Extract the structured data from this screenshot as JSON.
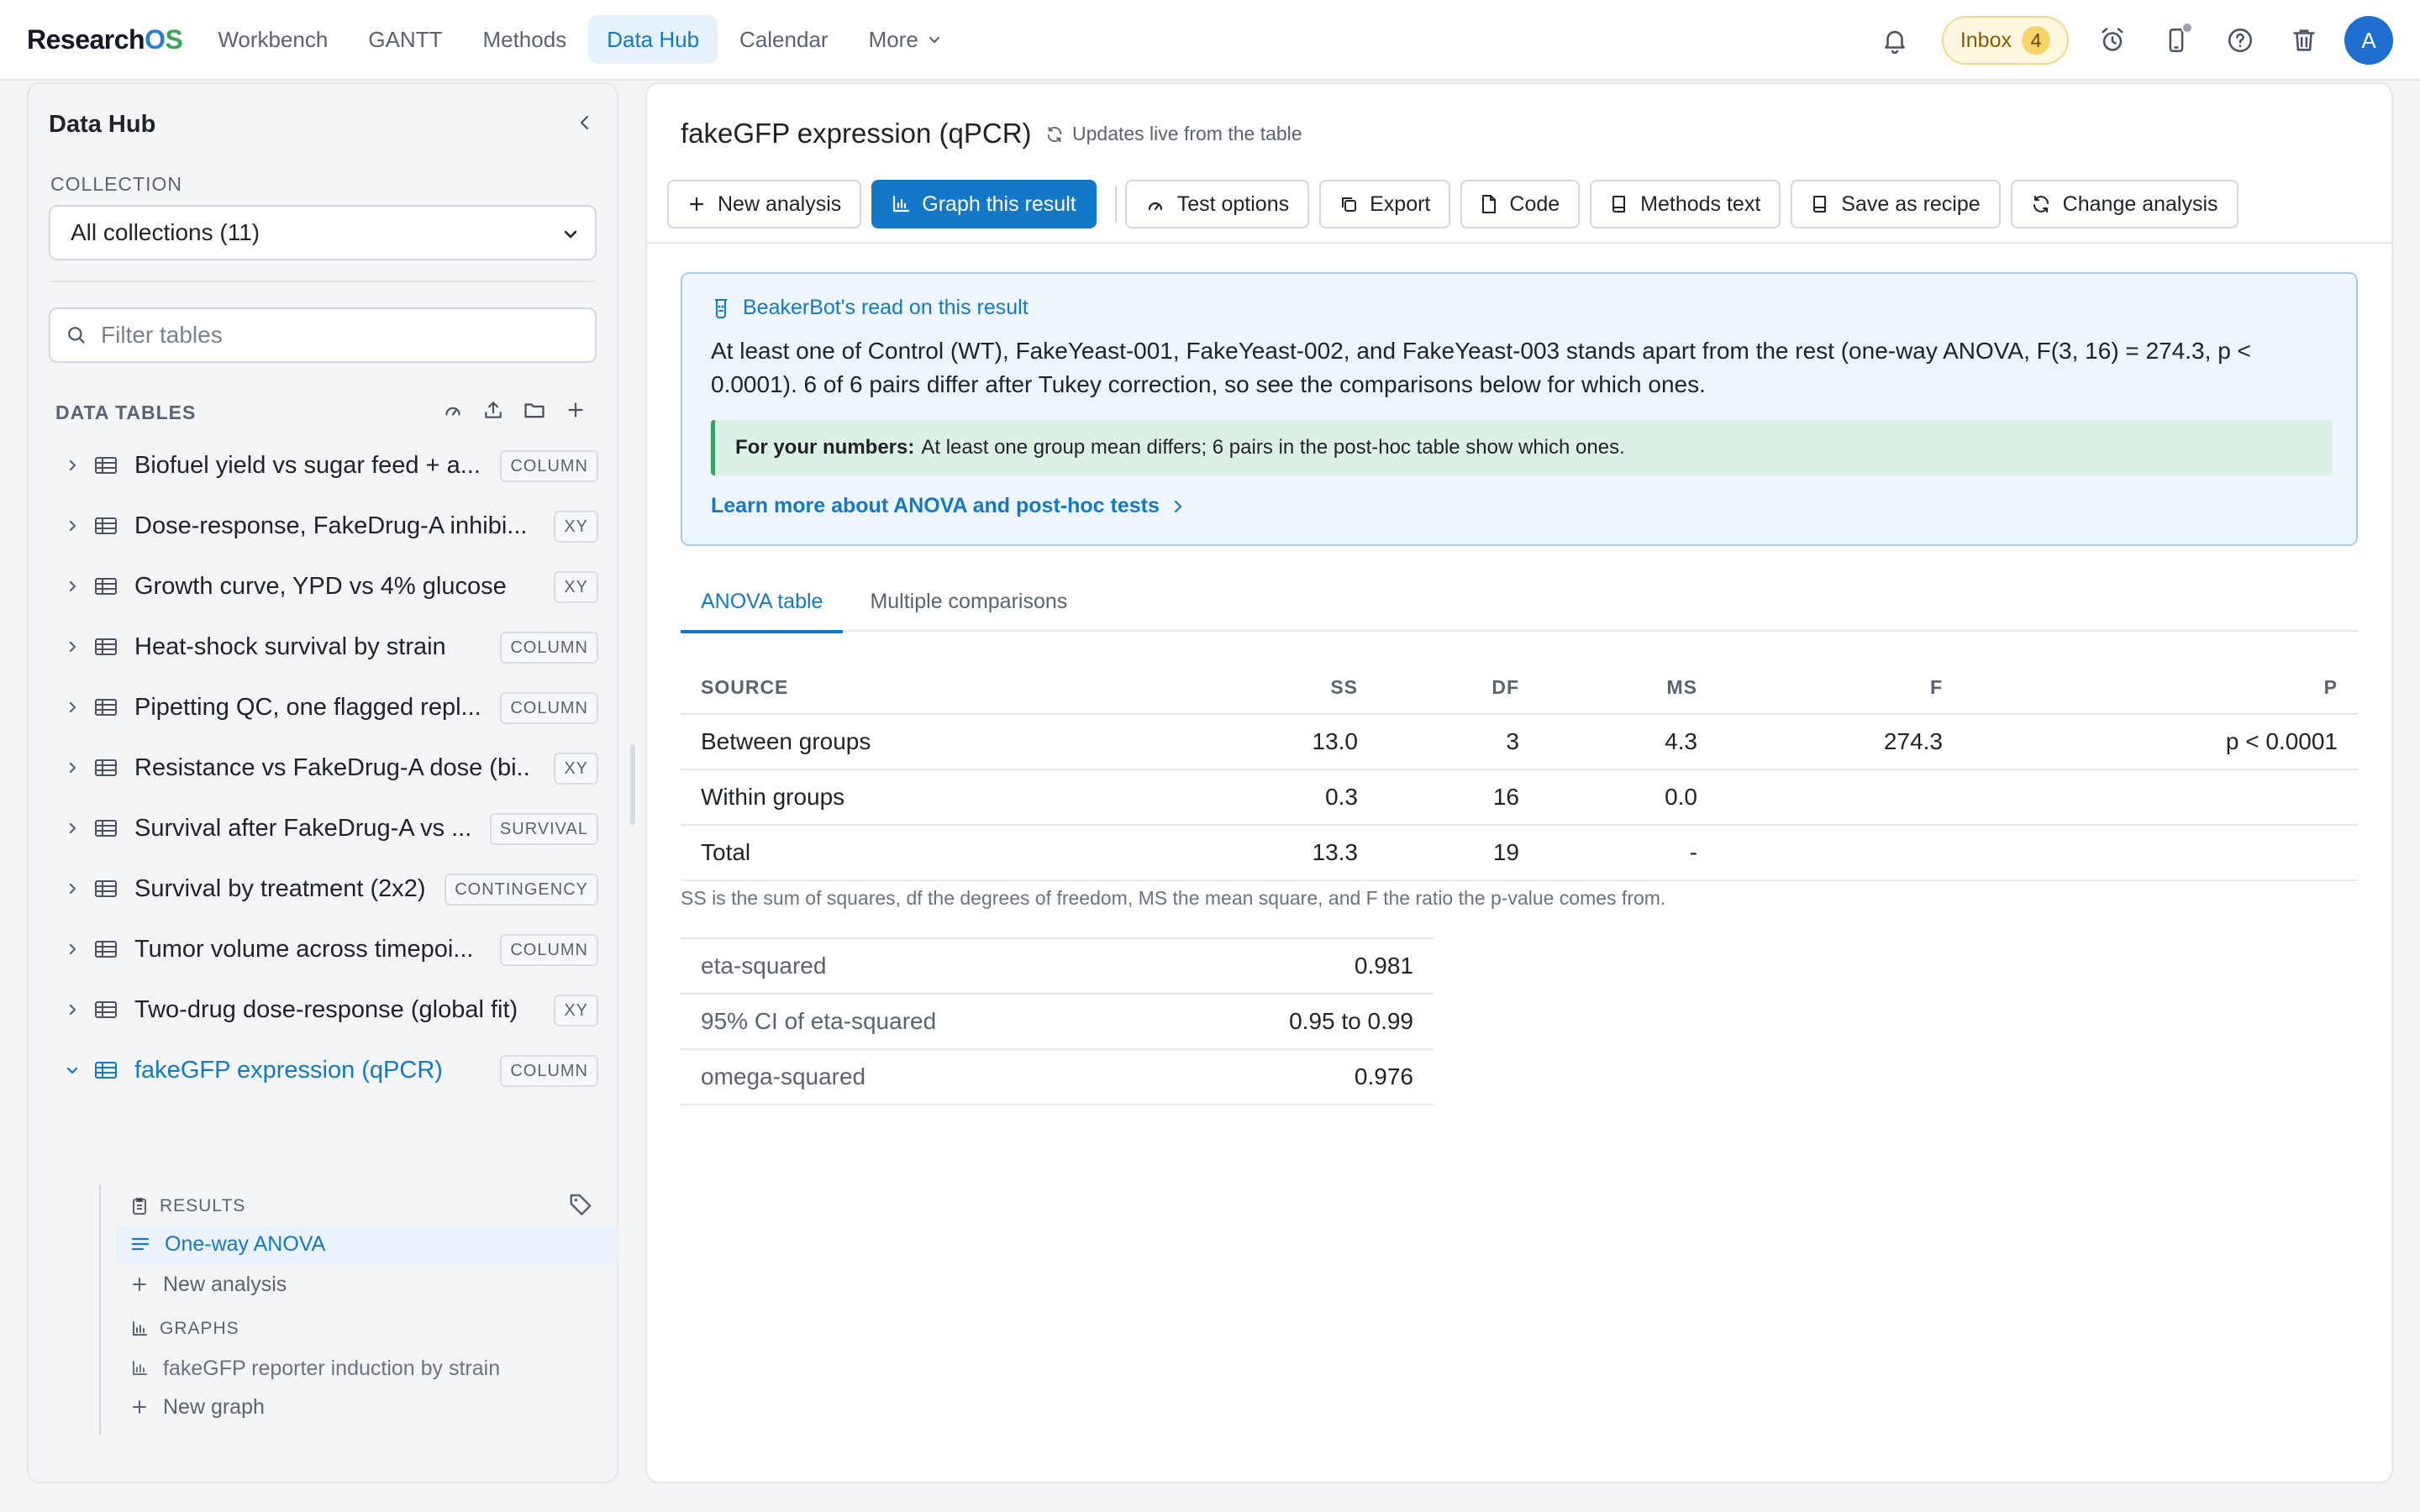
{
  "app": {
    "logo": {
      "part1": "Research",
      "part2": "O",
      "part3": "S"
    },
    "nav": [
      {
        "label": "Workbench",
        "active": false
      },
      {
        "label": "GANTT",
        "active": false
      },
      {
        "label": "Methods",
        "active": false
      },
      {
        "label": "Data Hub",
        "active": true
      },
      {
        "label": "Calendar",
        "active": false
      },
      {
        "label": "More",
        "active": false
      }
    ],
    "inbox": {
      "label": "Inbox",
      "count": "4"
    },
    "avatar": "A",
    "accent": "#1478c8"
  },
  "sidebar": {
    "title": "Data Hub",
    "collection_label": "COLLECTION",
    "collection_value": "All collections (11)",
    "filter_placeholder": "Filter tables",
    "data_tables_label": "DATA TABLES",
    "tables": [
      {
        "name": "Biofuel yield vs sugar feed + a...",
        "badge": "COLUMN"
      },
      {
        "name": "Dose-response, FakeDrug-A inhibi...",
        "badge": "XY"
      },
      {
        "name": "Growth curve, YPD vs 4% glucose",
        "badge": "XY"
      },
      {
        "name": "Heat-shock survival by strain",
        "badge": "COLUMN"
      },
      {
        "name": "Pipetting QC, one flagged repl...",
        "badge": "COLUMN"
      },
      {
        "name": "Resistance vs FakeDrug-A dose (bi...",
        "badge": "XY"
      },
      {
        "name": "Survival after FakeDrug-A vs ...",
        "badge": "SURVIVAL"
      },
      {
        "name": "Survival by treatment (2x2)",
        "badge": "CONTINGENCY"
      },
      {
        "name": "Tumor volume across timepoi...",
        "badge": "COLUMN"
      },
      {
        "name": "Two-drug dose-response (global fit)",
        "badge": "XY"
      },
      {
        "name": "fakeGFP expression (qPCR)",
        "badge": "COLUMN"
      }
    ],
    "results_label": "RESULTS",
    "result_item": "One-way ANOVA",
    "new_analysis": "New analysis",
    "graphs_label": "GRAPHS",
    "graph_item": "fakeGFP reporter induction by strain",
    "new_graph": "New graph"
  },
  "main": {
    "title": "fakeGFP expression (qPCR)",
    "live_note": "Updates live from the table",
    "toolbar": {
      "new_analysis": "New analysis",
      "graph": "Graph this result",
      "test_options": "Test options",
      "export": "Export",
      "code": "Code",
      "methods_text": "Methods text",
      "save_recipe": "Save as recipe",
      "change_analysis": "Change analysis"
    },
    "insight": {
      "heading": "BeakerBot's read on this result",
      "body": "At least one of Control (WT), FakeYeast-001, FakeYeast-002, and FakeYeast-003 stands apart from the rest (one-way ANOVA, F(3, 16) = 274.3, p < 0.0001). 6 of 6 pairs differ after Tukey correction, so see the comparisons below for which ones.",
      "note_bold": "For your numbers:",
      "note_text": "At least one group mean differs; 6 pairs in the post-hoc table show which ones.",
      "link": "Learn more about ANOVA and post-hoc tests"
    },
    "tabs": [
      {
        "label": "ANOVA table",
        "active": true
      },
      {
        "label": "Multiple comparisons",
        "active": false
      }
    ],
    "anova": {
      "headers": [
        "SOURCE",
        "SS",
        "DF",
        "MS",
        "F",
        "P"
      ],
      "rows": [
        [
          "Between groups",
          "13.0",
          "3",
          "4.3",
          "274.3",
          "p < 0.0001"
        ],
        [
          "Within groups",
          "0.3",
          "16",
          "0.0",
          "",
          ""
        ],
        [
          "Total",
          "13.3",
          "19",
          "-",
          "",
          ""
        ]
      ]
    },
    "footnote": "SS is the sum of squares, df the degrees of freedom, MS the mean square, and F the ratio the p-value comes from.",
    "effects": [
      {
        "label": "eta-squared",
        "value": "0.981"
      },
      {
        "label": "95% CI of eta-squared",
        "value": "0.95 to 0.99"
      },
      {
        "label": "omega-squared",
        "value": "0.976"
      }
    ]
  }
}
